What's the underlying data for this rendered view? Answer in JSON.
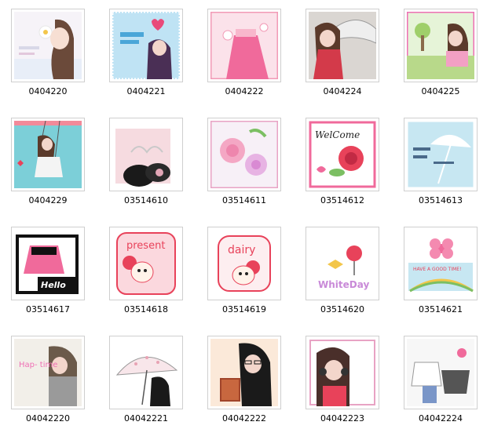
{
  "gallery": {
    "items": [
      {
        "label": "0404220",
        "thumb_icon": "girl-with-flower-icon"
      },
      {
        "label": "0404221",
        "thumb_icon": "girl-with-heart-icon"
      },
      {
        "label": "0404222",
        "thumb_icon": "pink-dress-icon"
      },
      {
        "label": "0404224",
        "thumb_icon": "girl-with-umbrella-icon"
      },
      {
        "label": "0404225",
        "thumb_icon": "girl-in-park-icon"
      },
      {
        "label": "0404229",
        "thumb_icon": "girl-on-swing-icon"
      },
      {
        "label": "03514610",
        "thumb_icon": "tiara-icon"
      },
      {
        "label": "03514611",
        "thumb_icon": "roses-icon"
      },
      {
        "label": "03514612",
        "thumb_icon": "welcome-rose-icon"
      },
      {
        "label": "03514613",
        "thumb_icon": "blue-umbrella-icon"
      },
      {
        "label": "03514617",
        "thumb_icon": "hello-dress-icon"
      },
      {
        "label": "03514618",
        "thumb_icon": "present-icon"
      },
      {
        "label": "03514619",
        "thumb_icon": "dairy-icon"
      },
      {
        "label": "03514620",
        "thumb_icon": "white-day-icon"
      },
      {
        "label": "03514621",
        "thumb_icon": "have-a-good-time-icon"
      },
      {
        "label": "04042220",
        "thumb_icon": "happy-time-girl-icon"
      },
      {
        "label": "04042221",
        "thumb_icon": "polka-umbrella-icon"
      },
      {
        "label": "04042222",
        "thumb_icon": "girl-reading-icon"
      },
      {
        "label": "04042223",
        "thumb_icon": "girl-with-headphones-icon"
      },
      {
        "label": "04042224",
        "thumb_icon": "fashion-clothes-icon"
      }
    ],
    "thumb_text": {
      "welcome": "WelCome",
      "hello": "Hello",
      "present": "present",
      "dairy": "dairy",
      "white_day": "WhiteDay",
      "good_time": "HAVE A GOOD TIME!",
      "happy_time": "Hap- time"
    }
  }
}
